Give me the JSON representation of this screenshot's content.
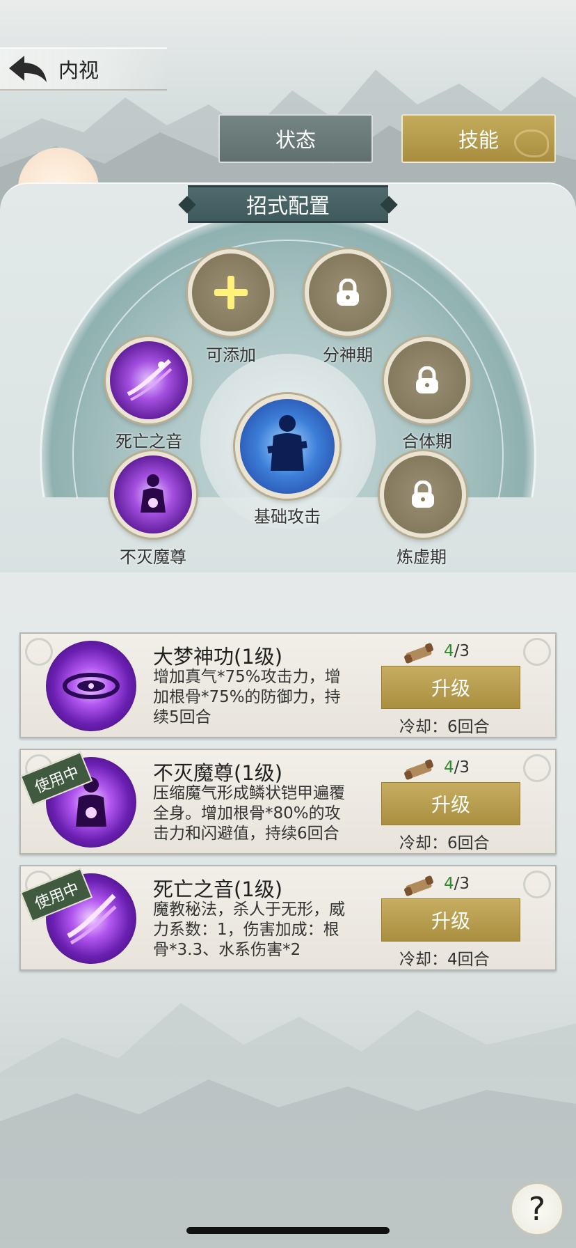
{
  "header": {
    "title": "内视"
  },
  "tabs": [
    {
      "label": "状态",
      "active": false
    },
    {
      "label": "技能",
      "active": true
    }
  ],
  "formation": {
    "title": "招式配置",
    "slots": [
      {
        "label": "可添加",
        "state": "add"
      },
      {
        "label": "分神期",
        "state": "locked"
      },
      {
        "label": "死亡之音",
        "state": "equipped"
      },
      {
        "label": "合体期",
        "state": "locked"
      },
      {
        "label": "基础攻击",
        "state": "equipped"
      },
      {
        "label": "不灭魔尊",
        "state": "equipped"
      },
      {
        "label": "炼虚期",
        "state": "locked"
      }
    ]
  },
  "skills": [
    {
      "name": "大梦神功(1级)",
      "desc": "增加真气*75%攻击力，增加根骨*75%的防御力，持续5回合",
      "have": "4",
      "need": "/3",
      "upgrade": "升级",
      "cooldown": "冷却：6回合",
      "badge": ""
    },
    {
      "name": "不灭魔尊(1级)",
      "desc": "压缩魔气形成鳞状铠甲遍覆全身。增加根骨*80%的攻击力和闪避值，持续6回合",
      "have": "4",
      "need": "/3",
      "upgrade": "升级",
      "cooldown": "冷却：6回合",
      "badge": "使用中"
    },
    {
      "name": "死亡之音(1级)",
      "desc": "魔教秘法，杀人于无形，威力系数：1，伤害加成：根骨*3.3、水系伤害*2",
      "have": "4",
      "need": "/3",
      "upgrade": "升级",
      "cooldown": "冷却：4回合",
      "badge": "使用中"
    }
  ],
  "help": {
    "label": "?"
  },
  "colors": {
    "gold": "#b8a04f",
    "teal": "#4e6a6c",
    "lock": "#8a7f63",
    "have": "#2d8a2d"
  }
}
